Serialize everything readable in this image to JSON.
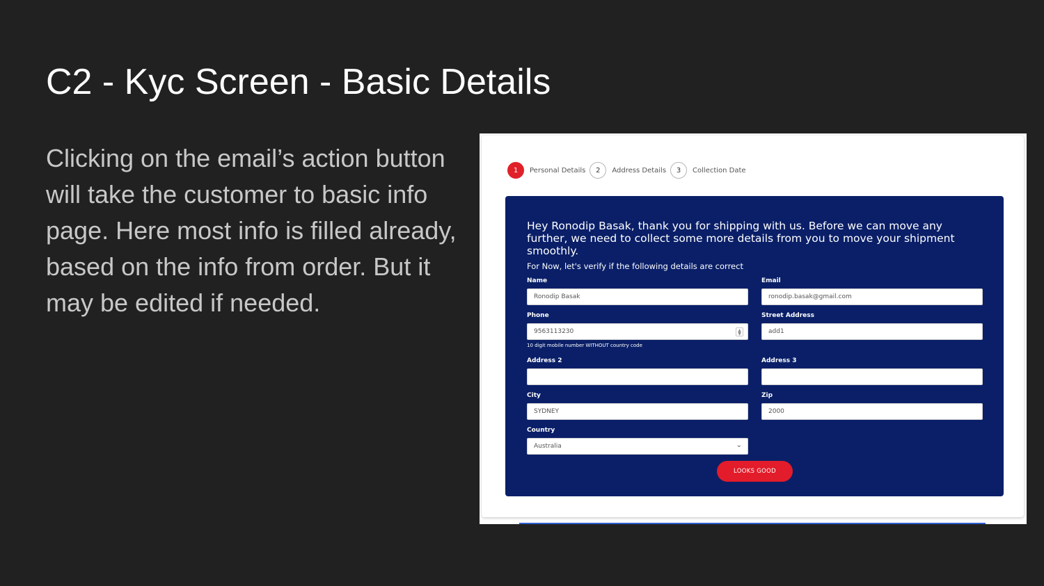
{
  "slide": {
    "title": "C2 - Kyc Screen - Basic Details",
    "body": "Clicking on the email’s action button will take the customer to basic info page. Here most info is filled already, based on the info from order. But it may be edited if needed."
  },
  "stepper": {
    "steps": [
      {
        "number": "1",
        "label": "Personal Details"
      },
      {
        "number": "2",
        "label": "Address Details"
      },
      {
        "number": "3",
        "label": "Collection Date"
      }
    ]
  },
  "form": {
    "intro": "Hey Ronodip Basak, thank you for shipping with us. Before we can move any further, we need to collect some more details from you to move your shipment smoothly.",
    "sub_intro": "For Now, let's verify if the following details are correct",
    "name": {
      "label": "Name",
      "value": "Ronodip Basak"
    },
    "email": {
      "label": "Email",
      "value": "ronodip.basak@gmail.com"
    },
    "phone": {
      "label": "Phone",
      "value": "9563113230",
      "hint": "10 digit mobile number WITHOUT country code"
    },
    "street_address": {
      "label": "Street Address",
      "value": "add1"
    },
    "address2": {
      "label": "Address 2",
      "value": ""
    },
    "address3": {
      "label": "Address 3",
      "value": ""
    },
    "city": {
      "label": "City",
      "value": "SYDNEY"
    },
    "zip": {
      "label": "Zip",
      "value": "2000"
    },
    "country": {
      "label": "Country",
      "value": "Australia"
    },
    "submit_label": "LOOKS GOOD"
  },
  "colors": {
    "slide_bg": "#212121",
    "panel_bg": "#0a1f68",
    "accent_red": "#e21c2a"
  }
}
